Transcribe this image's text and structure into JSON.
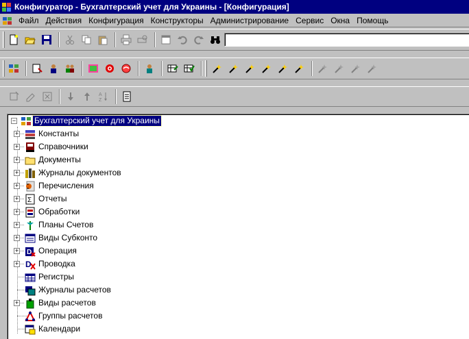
{
  "window": {
    "title": "Конфигуратор - Бухгалтерский учет для Украины - [Конфигурация]"
  },
  "menu": {
    "items": [
      "Файл",
      "Действия",
      "Конфигурация",
      "Конструкторы",
      "Администрирование",
      "Сервис",
      "Окна",
      "Помощь"
    ]
  },
  "toolbar1": {
    "search_value": ""
  },
  "tree": {
    "root": "Бухгалтерский учет для Украины",
    "items": [
      {
        "label": "Константы",
        "expandable": true
      },
      {
        "label": "Справочники",
        "expandable": true
      },
      {
        "label": "Документы",
        "expandable": true
      },
      {
        "label": "Журналы документов",
        "expandable": true
      },
      {
        "label": "Перечисления",
        "expandable": true
      },
      {
        "label": "Отчеты",
        "expandable": true
      },
      {
        "label": "Обработки",
        "expandable": true
      },
      {
        "label": "Планы Счетов",
        "expandable": true
      },
      {
        "label": "Виды Субконто",
        "expandable": true
      },
      {
        "label": "Операция",
        "expandable": true
      },
      {
        "label": "Проводка",
        "expandable": true
      },
      {
        "label": "Регистры",
        "expandable": false
      },
      {
        "label": "Журналы расчетов",
        "expandable": false
      },
      {
        "label": "Виды расчетов",
        "expandable": true
      },
      {
        "label": "Группы расчетов",
        "expandable": false
      },
      {
        "label": "Календари",
        "expandable": false
      }
    ]
  },
  "colors": {
    "titlebar": "#000080",
    "selection": "#000080",
    "face": "#c0c0c0"
  }
}
